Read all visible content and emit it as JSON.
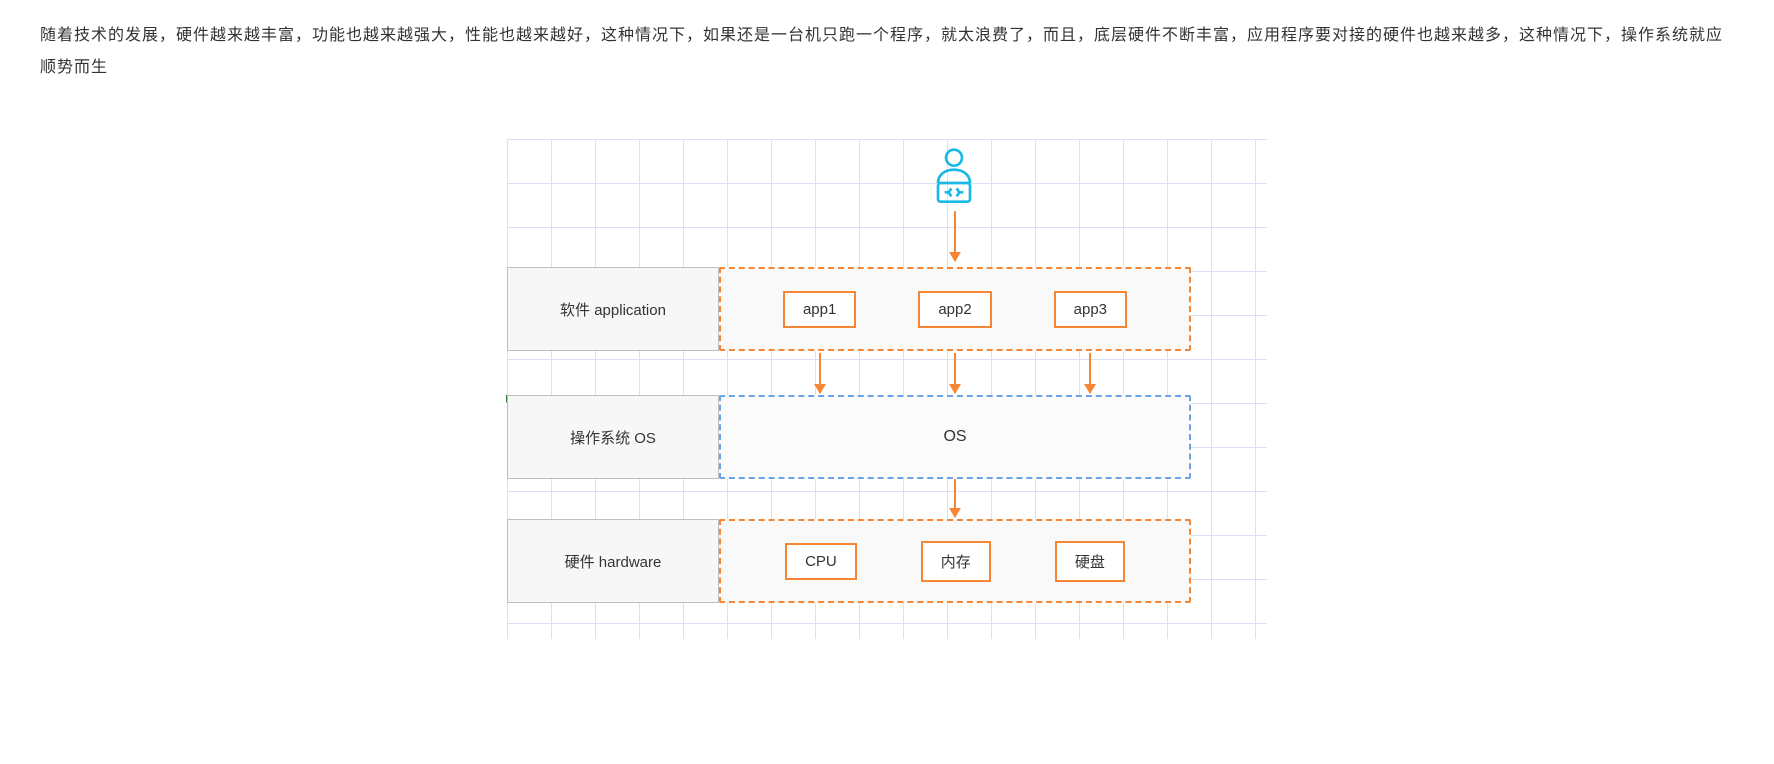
{
  "paragraph": "随着技术的发展，硬件越来越丰富，功能也越来越强大，性能也越来越好，这种情况下，如果还是一台机只跑一个程序，就太浪费了，而且，底层硬件不断丰富，应用程序要对接的硬件也越来越多，这种情况下，操作系统就应顺势而生",
  "rows": {
    "application": {
      "label": "软件 application",
      "nodes": [
        "app1",
        "app2",
        "app3"
      ]
    },
    "os": {
      "label": "操作系统 OS",
      "text": "OS"
    },
    "hardware": {
      "label": "硬件 hardware",
      "nodes": [
        "CPU",
        "内存",
        "硬盘"
      ]
    }
  },
  "icon": "developer-icon",
  "colors": {
    "accent": "#f58634",
    "os_border": "#6aa4e6",
    "icon": "#1ab8e6",
    "grid": "#d9e2f0"
  }
}
